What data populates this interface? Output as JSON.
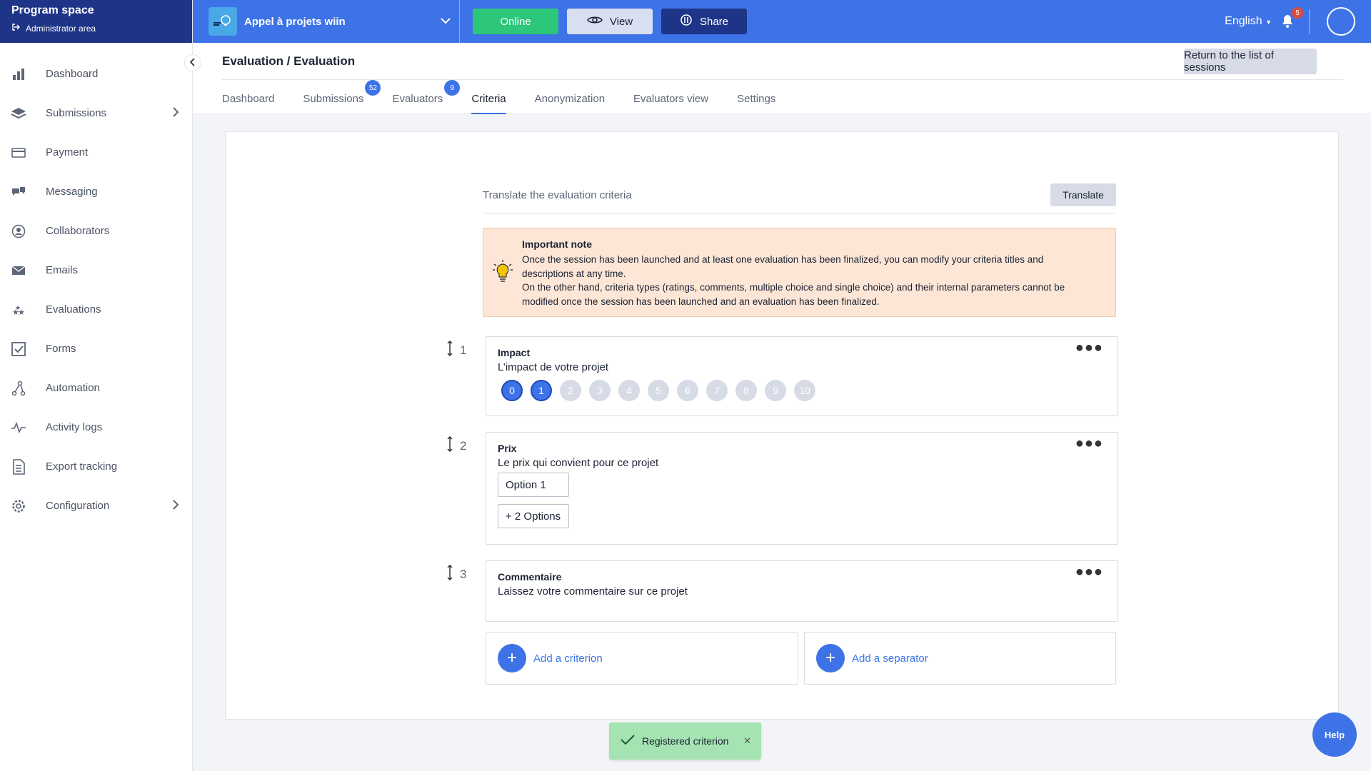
{
  "sidebar": {
    "brand_title": "Program space",
    "brand_sub": "Administrator area",
    "items": [
      {
        "label": "Dashboard",
        "icon": "bar-chart-icon"
      },
      {
        "label": "Submissions",
        "icon": "layers-icon",
        "chevron": true
      },
      {
        "label": "Payment",
        "icon": "card-icon"
      },
      {
        "label": "Messaging",
        "icon": "chat-icon"
      },
      {
        "label": "Collaborators",
        "icon": "user-circle-icon"
      },
      {
        "label": "Emails",
        "icon": "envelope-icon"
      },
      {
        "label": "Evaluations",
        "icon": "stars-icon"
      },
      {
        "label": "Forms",
        "icon": "checkbox-icon"
      },
      {
        "label": "Automation",
        "icon": "flow-icon"
      },
      {
        "label": "Activity logs",
        "icon": "pulse-icon"
      },
      {
        "label": "Export tracking",
        "icon": "document-icon"
      },
      {
        "label": "Configuration",
        "icon": "gear-icon",
        "chevron": true
      }
    ]
  },
  "topbar": {
    "program_name": "Appel à projets wiin",
    "online_label": "Online",
    "view_label": "View",
    "share_label": "Share",
    "language": "English",
    "notification_count": "5"
  },
  "header": {
    "title": "Evaluation / Evaluation",
    "return_label": "Return to the list of sessions",
    "tabs": [
      {
        "label": "Dashboard"
      },
      {
        "label": "Submissions",
        "badge": "52"
      },
      {
        "label": "Evaluators",
        "badge": "9"
      },
      {
        "label": "Criteria",
        "active": true
      },
      {
        "label": "Anonymization"
      },
      {
        "label": "Evaluators view"
      },
      {
        "label": "Settings"
      }
    ]
  },
  "main": {
    "translate_text": "Translate the evaluation criteria",
    "translate_button": "Translate",
    "note": {
      "title": "Important note",
      "line1": "Once the session has been launched and at least one evaluation has been finalized, you can modify your criteria titles and descriptions at any time.",
      "line2": "On the other hand, criteria types (ratings, comments, multiple choice and single choice) and their internal parameters cannot be modified once the session has been launched and an evaluation has been finalized."
    },
    "criteria": [
      {
        "number": "1",
        "title": "Impact",
        "description": "L’impact de votre projet",
        "scale": [
          "0",
          "1",
          "2",
          "3",
          "4",
          "5",
          "6",
          "7",
          "8",
          "9",
          "10"
        ],
        "selected_through": 1
      },
      {
        "number": "2",
        "title": "Prix",
        "description": "Le prix qui convient pour ce projet",
        "option": "Option 1",
        "more_options": "+ 2 Options"
      },
      {
        "number": "3",
        "title": "Commentaire",
        "description": "Laissez votre commentaire sur ce projet"
      }
    ],
    "add_criterion": "Add a criterion",
    "add_separator": "Add a separator"
  },
  "toast": {
    "message": "Registered criterion"
  },
  "help_label": "Help",
  "colors": {
    "primary": "#3d73e6",
    "navy": "#1e3486",
    "online": "#2dc77b",
    "note_bg": "#fde6d6",
    "toast_bg": "#a5e3b2"
  }
}
